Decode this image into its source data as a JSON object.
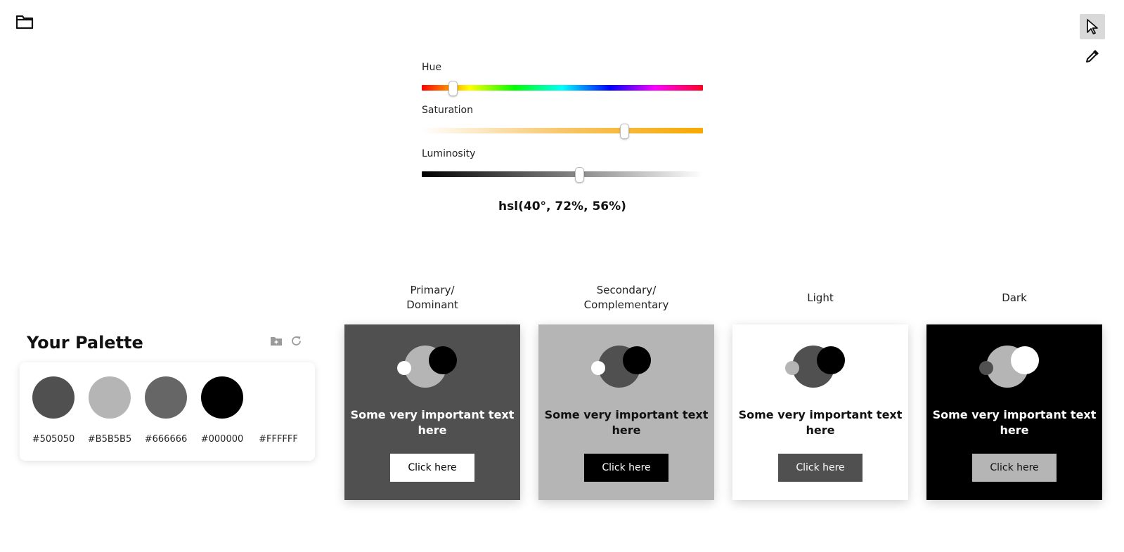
{
  "toolbar": {
    "folder_icon": "folder-icon",
    "pointer_icon": "pointer-icon",
    "eyedropper_icon": "eyedropper-icon"
  },
  "sliders": {
    "hue": {
      "label": "Hue",
      "value": 40,
      "max": 360
    },
    "saturation": {
      "label": "Saturation",
      "value": 72,
      "max": 100
    },
    "luminosity": {
      "label": "Luminosity",
      "value": 56,
      "max": 100
    }
  },
  "readout": "hsl(40°, 72%, 56%)",
  "palette": {
    "title": "Your Palette",
    "icons": [
      "folder-plus-icon",
      "refresh-icon"
    ],
    "swatches": [
      {
        "hex": "#505050",
        "color": "#505050"
      },
      {
        "hex": "#B5B5B5",
        "color": "#B5B5B5"
      },
      {
        "hex": "#666666",
        "color": "#666666"
      },
      {
        "hex": "#000000",
        "color": "#000000"
      },
      {
        "hex": "#FFFFFF",
        "color": "#FFFFFF"
      }
    ]
  },
  "previews": [
    {
      "label": "Primary/\nDominant",
      "bg": "#505050",
      "text_color": "#ffffff",
      "text": "Some very important text here",
      "button_label": "Click here",
      "button_bg": "#ffffff",
      "button_fg": "#000000",
      "big_circle": "#b5b5b5",
      "top_circle": "#000000",
      "small_circle": "#ffffff"
    },
    {
      "label": "Secondary/\nComplementary",
      "bg": "#b5b5b5",
      "text_color": "#111111",
      "text": "Some very important text here",
      "button_label": "Click here",
      "button_bg": "#000000",
      "button_fg": "#ffffff",
      "big_circle": "#505050",
      "top_circle": "#000000",
      "small_circle": "#ffffff"
    },
    {
      "label": "Light",
      "bg": "#ffffff",
      "text_color": "#111111",
      "text": "Some very important text here",
      "button_label": "Click here",
      "button_bg": "#505050",
      "button_fg": "#ffffff",
      "big_circle": "#505050",
      "top_circle": "#000000",
      "small_circle": "#b5b5b5"
    },
    {
      "label": "Dark",
      "bg": "#000000",
      "text_color": "#ffffff",
      "text": "Some very important text here",
      "button_label": "Click here",
      "button_bg": "#b5b5b5",
      "button_fg": "#111111",
      "big_circle": "#b5b5b5",
      "top_circle": "#ffffff",
      "small_circle": "#505050"
    }
  ]
}
